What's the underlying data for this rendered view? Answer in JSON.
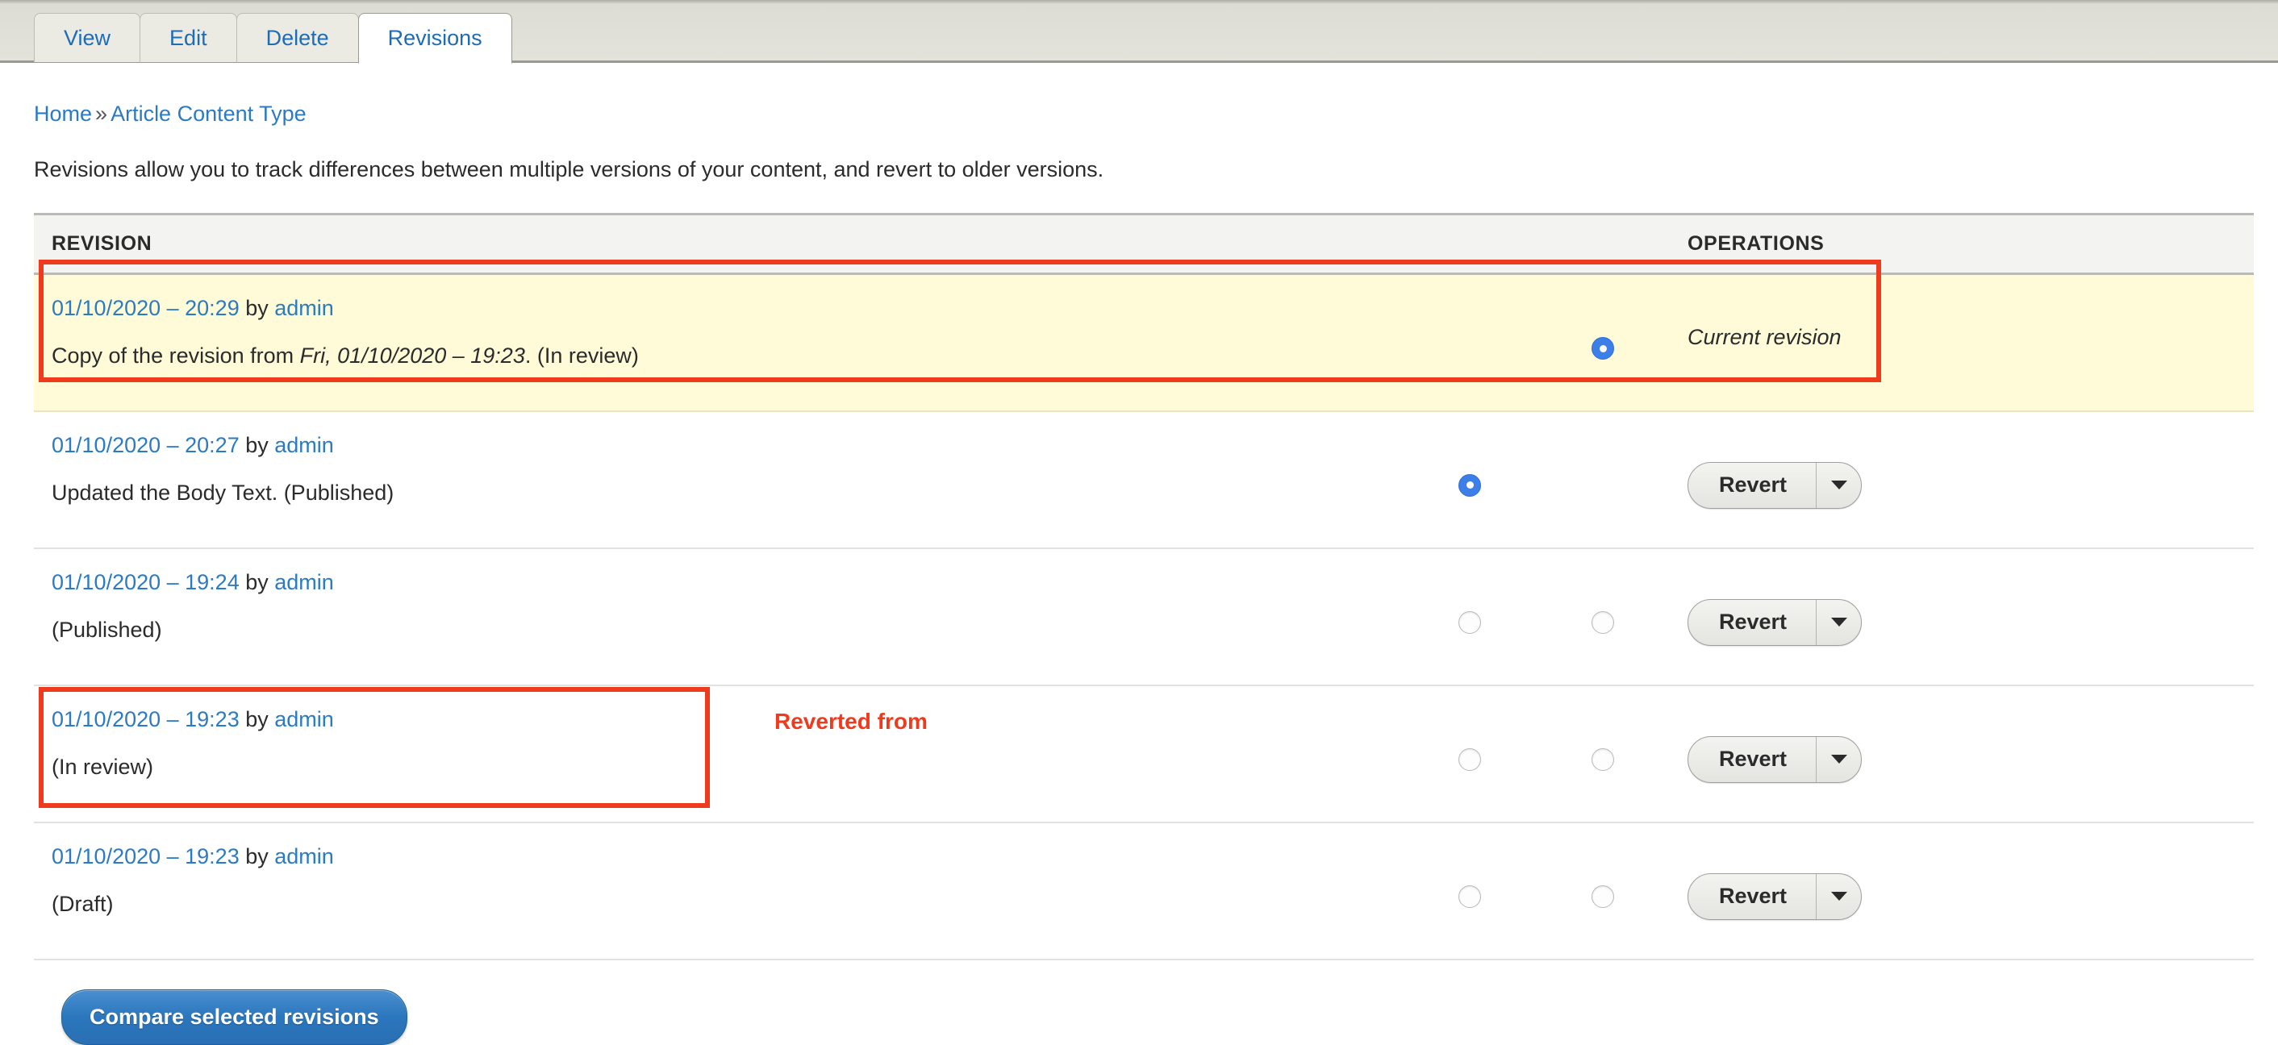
{
  "tabs": [
    {
      "label": "View",
      "active": false
    },
    {
      "label": "Edit",
      "active": false
    },
    {
      "label": "Delete",
      "active": false
    },
    {
      "label": "Revisions",
      "active": true
    }
  ],
  "breadcrumb": {
    "home": "Home",
    "separator": "»",
    "current": "Article Content Type"
  },
  "intro": "Revisions allow you to track differences between multiple versions of your content, and revert to older versions.",
  "table": {
    "headers": {
      "revision": "REVISION",
      "operations": "OPERATIONS"
    },
    "rows": [
      {
        "date": "01/10/2020 – 20:29",
        "by": " by ",
        "author": "admin",
        "message_prefix": "Copy of the revision from ",
        "message_italic": "Fri, 01/10/2020 – 19:23",
        "message_suffix": ". (In review)",
        "radio1": "none",
        "radio2": "checked",
        "operation": "Current revision",
        "operation_type": "text",
        "current": true,
        "mid_label": ""
      },
      {
        "date": "01/10/2020 – 20:27",
        "by": " by ",
        "author": "admin",
        "message_prefix": "Updated the Body Text. (Published)",
        "message_italic": "",
        "message_suffix": "",
        "radio1": "checked",
        "radio2": "none",
        "operation": "Revert",
        "operation_type": "dropbutton",
        "current": false,
        "mid_label": ""
      },
      {
        "date": "01/10/2020 – 19:24",
        "by": " by ",
        "author": "admin",
        "message_prefix": "(Published)",
        "message_italic": "",
        "message_suffix": "",
        "radio1": "unchecked",
        "radio2": "unchecked",
        "operation": "Revert",
        "operation_type": "dropbutton",
        "current": false,
        "mid_label": ""
      },
      {
        "date": "01/10/2020 – 19:23",
        "by": " by ",
        "author": "admin",
        "message_prefix": "(In review)",
        "message_italic": "",
        "message_suffix": "",
        "radio1": "unchecked",
        "radio2": "unchecked",
        "operation": "Revert",
        "operation_type": "dropbutton",
        "current": false,
        "mid_label": "Reverted from"
      },
      {
        "date": "01/10/2020 – 19:23",
        "by": " by ",
        "author": "admin",
        "message_prefix": "(Draft)",
        "message_italic": "",
        "message_suffix": "",
        "radio1": "unchecked",
        "radio2": "unchecked",
        "operation": "Revert",
        "operation_type": "dropbutton",
        "current": false,
        "mid_label": ""
      }
    ]
  },
  "actions": {
    "compare_label": "Compare selected revisions"
  },
  "annotations": {
    "highlight_color": "#ee3b1e",
    "reverted_from_label": "Reverted from"
  },
  "colors": {
    "link": "#2b7bc4",
    "current_row_bg": "#fffbd8",
    "annotation_red": "#ee3b1e",
    "primary_button": "#2b76bd"
  }
}
